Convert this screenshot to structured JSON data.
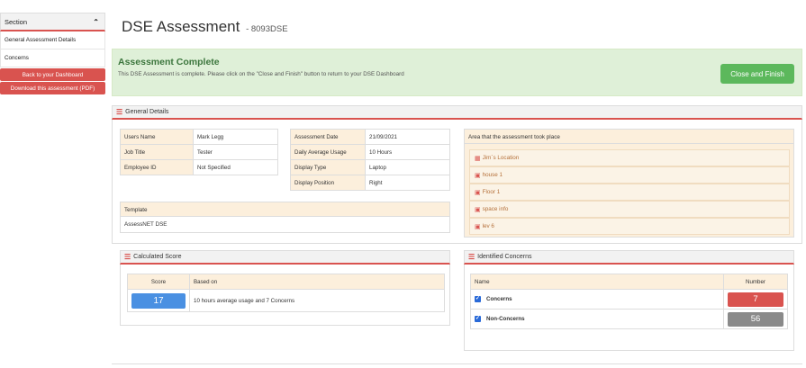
{
  "sidebar": {
    "header": "Section",
    "items": [
      "General Assessment Details",
      "Concerns"
    ],
    "buttons": [
      "Back to your Dashboard",
      "Download this assessment (PDF)"
    ]
  },
  "page": {
    "title": "DSE Assessment",
    "ref": "- 8093DSE"
  },
  "alert": {
    "title": "Assessment Complete",
    "text": "This DSE Assessment is complete. Please click on the \"Close and Finish\" button to return to your DSE Dashboard",
    "button": "Close and Finish"
  },
  "general": {
    "heading": "General Details",
    "user": [
      {
        "label": "Users Name",
        "value": "Mark Legg"
      },
      {
        "label": "Job Title",
        "value": "Tester"
      },
      {
        "label": "Employee ID",
        "value": "Not Specified"
      }
    ],
    "assessment": [
      {
        "label": "Assessment Date",
        "value": "21/09/2021"
      },
      {
        "label": "Daily Average Usage",
        "value": "10 Hours"
      },
      {
        "label": "Display Type",
        "value": "Laptop"
      },
      {
        "label": "Display Position",
        "value": "Right"
      }
    ],
    "template_label": "Template",
    "template_value": "AssessNET DSE",
    "area_label": "Area that the assessment took place",
    "areas": [
      "Jim`s Location",
      "house 1",
      "Floor 1",
      "space info",
      "lev 6"
    ]
  },
  "score": {
    "heading": "Calculated Score",
    "col_score": "Score",
    "col_based": "Based on",
    "value": "17",
    "based_on": "10 hours average usage and 7 Concerns"
  },
  "concerns": {
    "heading": "Identified Concerns",
    "col_name": "Name",
    "col_number": "Number",
    "rows": [
      {
        "name": "Concerns",
        "number": "7",
        "color": "#d9534f"
      },
      {
        "name": "Non-Concerns",
        "number": "56",
        "color": "#8a8a8a"
      }
    ]
  },
  "colors": {
    "accent": "#d9534f",
    "success": "#5cb85c",
    "score": "#4a90e2"
  }
}
